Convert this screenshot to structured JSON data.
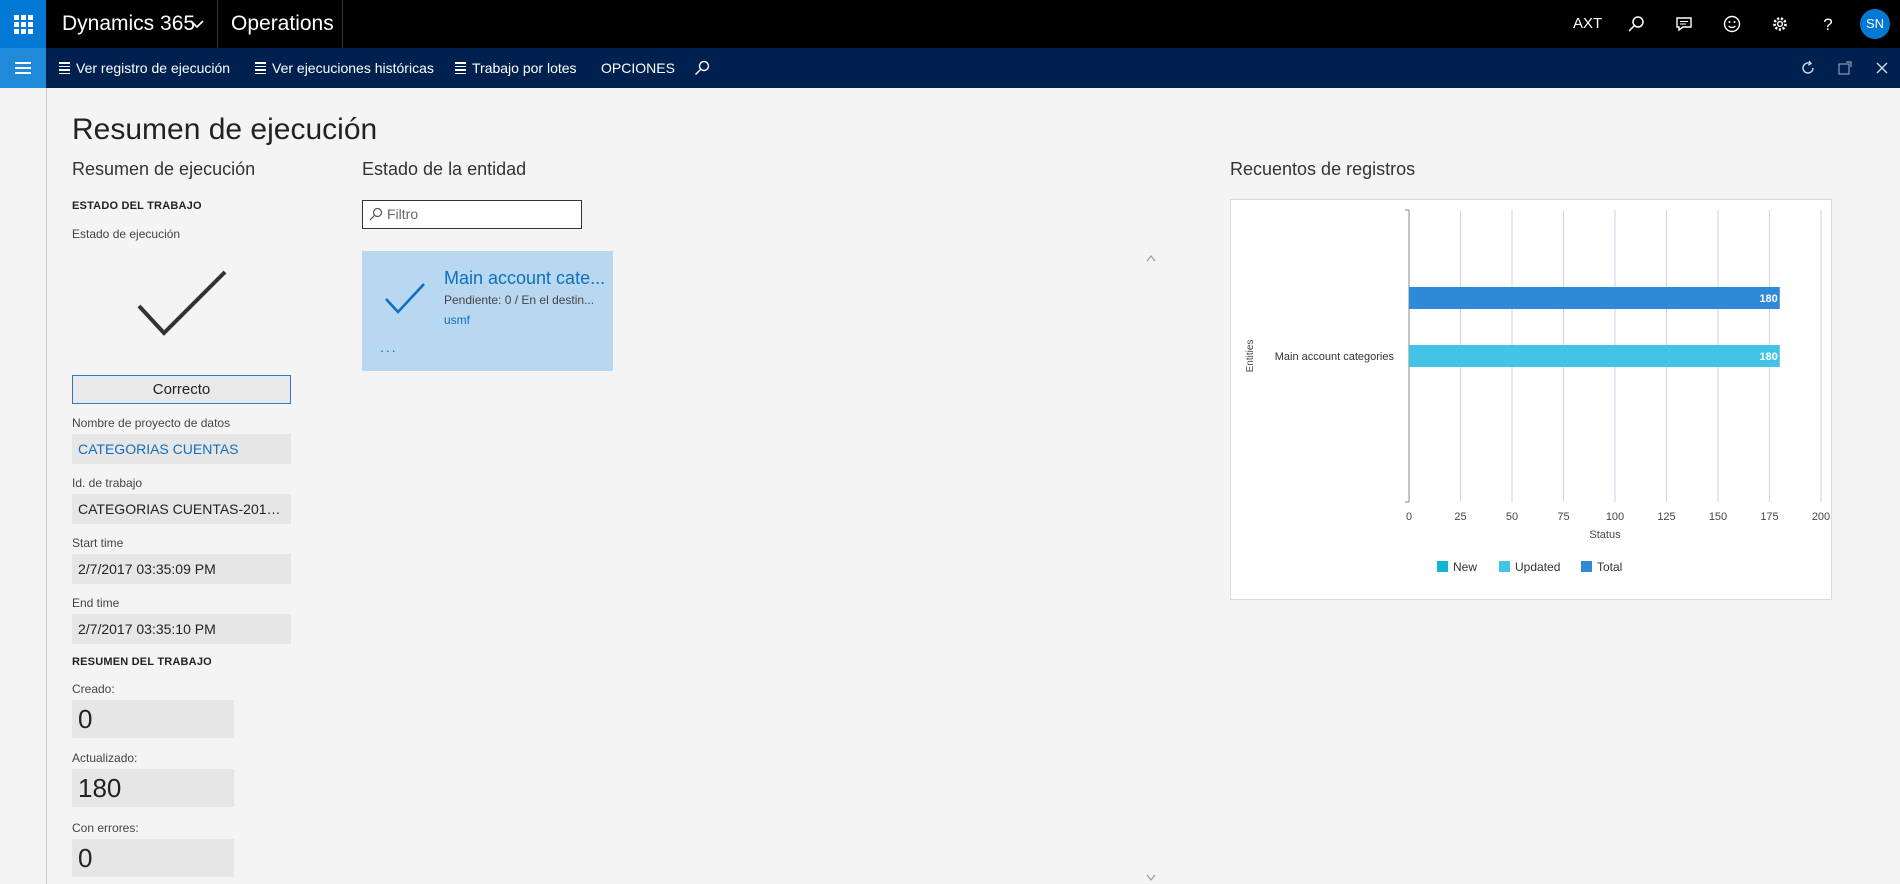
{
  "topbar": {
    "app_name": "Dynamics 365",
    "module": "Operations",
    "company": "AXT",
    "user_initials": "SN"
  },
  "actionbar": {
    "actions": [
      {
        "label": "Ver registro de ejecución"
      },
      {
        "label": "Ver ejecuciones históricas"
      },
      {
        "label": "Trabajo por lotes"
      },
      {
        "label": "OPCIONES"
      }
    ]
  },
  "page": {
    "title": "Resumen de ejecución"
  },
  "summary": {
    "heading": "Resumen de ejecución",
    "job_status_caps": "ESTADO DEL TRABAJO",
    "exec_status_label": "Estado de ejecución",
    "status_value": "Correcto",
    "project_label": "Nombre de proyecto de datos",
    "project_value": "CATEGORIAS CUENTAS",
    "job_id_label": "Id. de trabajo",
    "job_id_value": "CATEGORIAS CUENTAS-2017-0...",
    "start_label": "Start time",
    "start_value": "2/7/2017 03:35:09 PM",
    "end_label": "End time",
    "end_value": "2/7/2017 03:35:10 PM",
    "job_summary_caps": "RESUMEN DEL TRABAJO",
    "created_label": "Creado:",
    "created_value": "0",
    "updated_label": "Actualizado:",
    "updated_value": "180",
    "errors_label": "Con errores:",
    "errors_value": "0"
  },
  "entity": {
    "heading": "Estado de la entidad",
    "filter_placeholder": "Filtro",
    "tile_title": "Main account cate...",
    "tile_subtitle": "Pendiente: 0 / En el destin...",
    "tile_company": "usmf",
    "tile_more": "..."
  },
  "records": {
    "heading": "Recuentos de registros"
  },
  "chart_data": {
    "type": "bar",
    "orientation": "horizontal",
    "categories": [
      "Main account categories"
    ],
    "series": [
      {
        "name": "New",
        "values": [
          0
        ],
        "color": "#13b6cf"
      },
      {
        "name": "Updated",
        "values": [
          180
        ],
        "color": "#43c4e6"
      },
      {
        "name": "Total",
        "values": [
          180
        ],
        "color": "#2e8ad8"
      }
    ],
    "data_labels": [
      "180",
      "180"
    ],
    "xlabel": "Status",
    "ylabel": "Entities",
    "xlim": [
      0,
      200
    ],
    "xticks": [
      "0",
      "25",
      "50",
      "75",
      "100",
      "125",
      "150",
      "175",
      "200"
    ],
    "grid": true,
    "legend": "bottom"
  },
  "colors": {
    "topbar": "#000000",
    "actionbar": "#002050",
    "accent": "#0078d4",
    "tile": "#b8d7f0"
  }
}
